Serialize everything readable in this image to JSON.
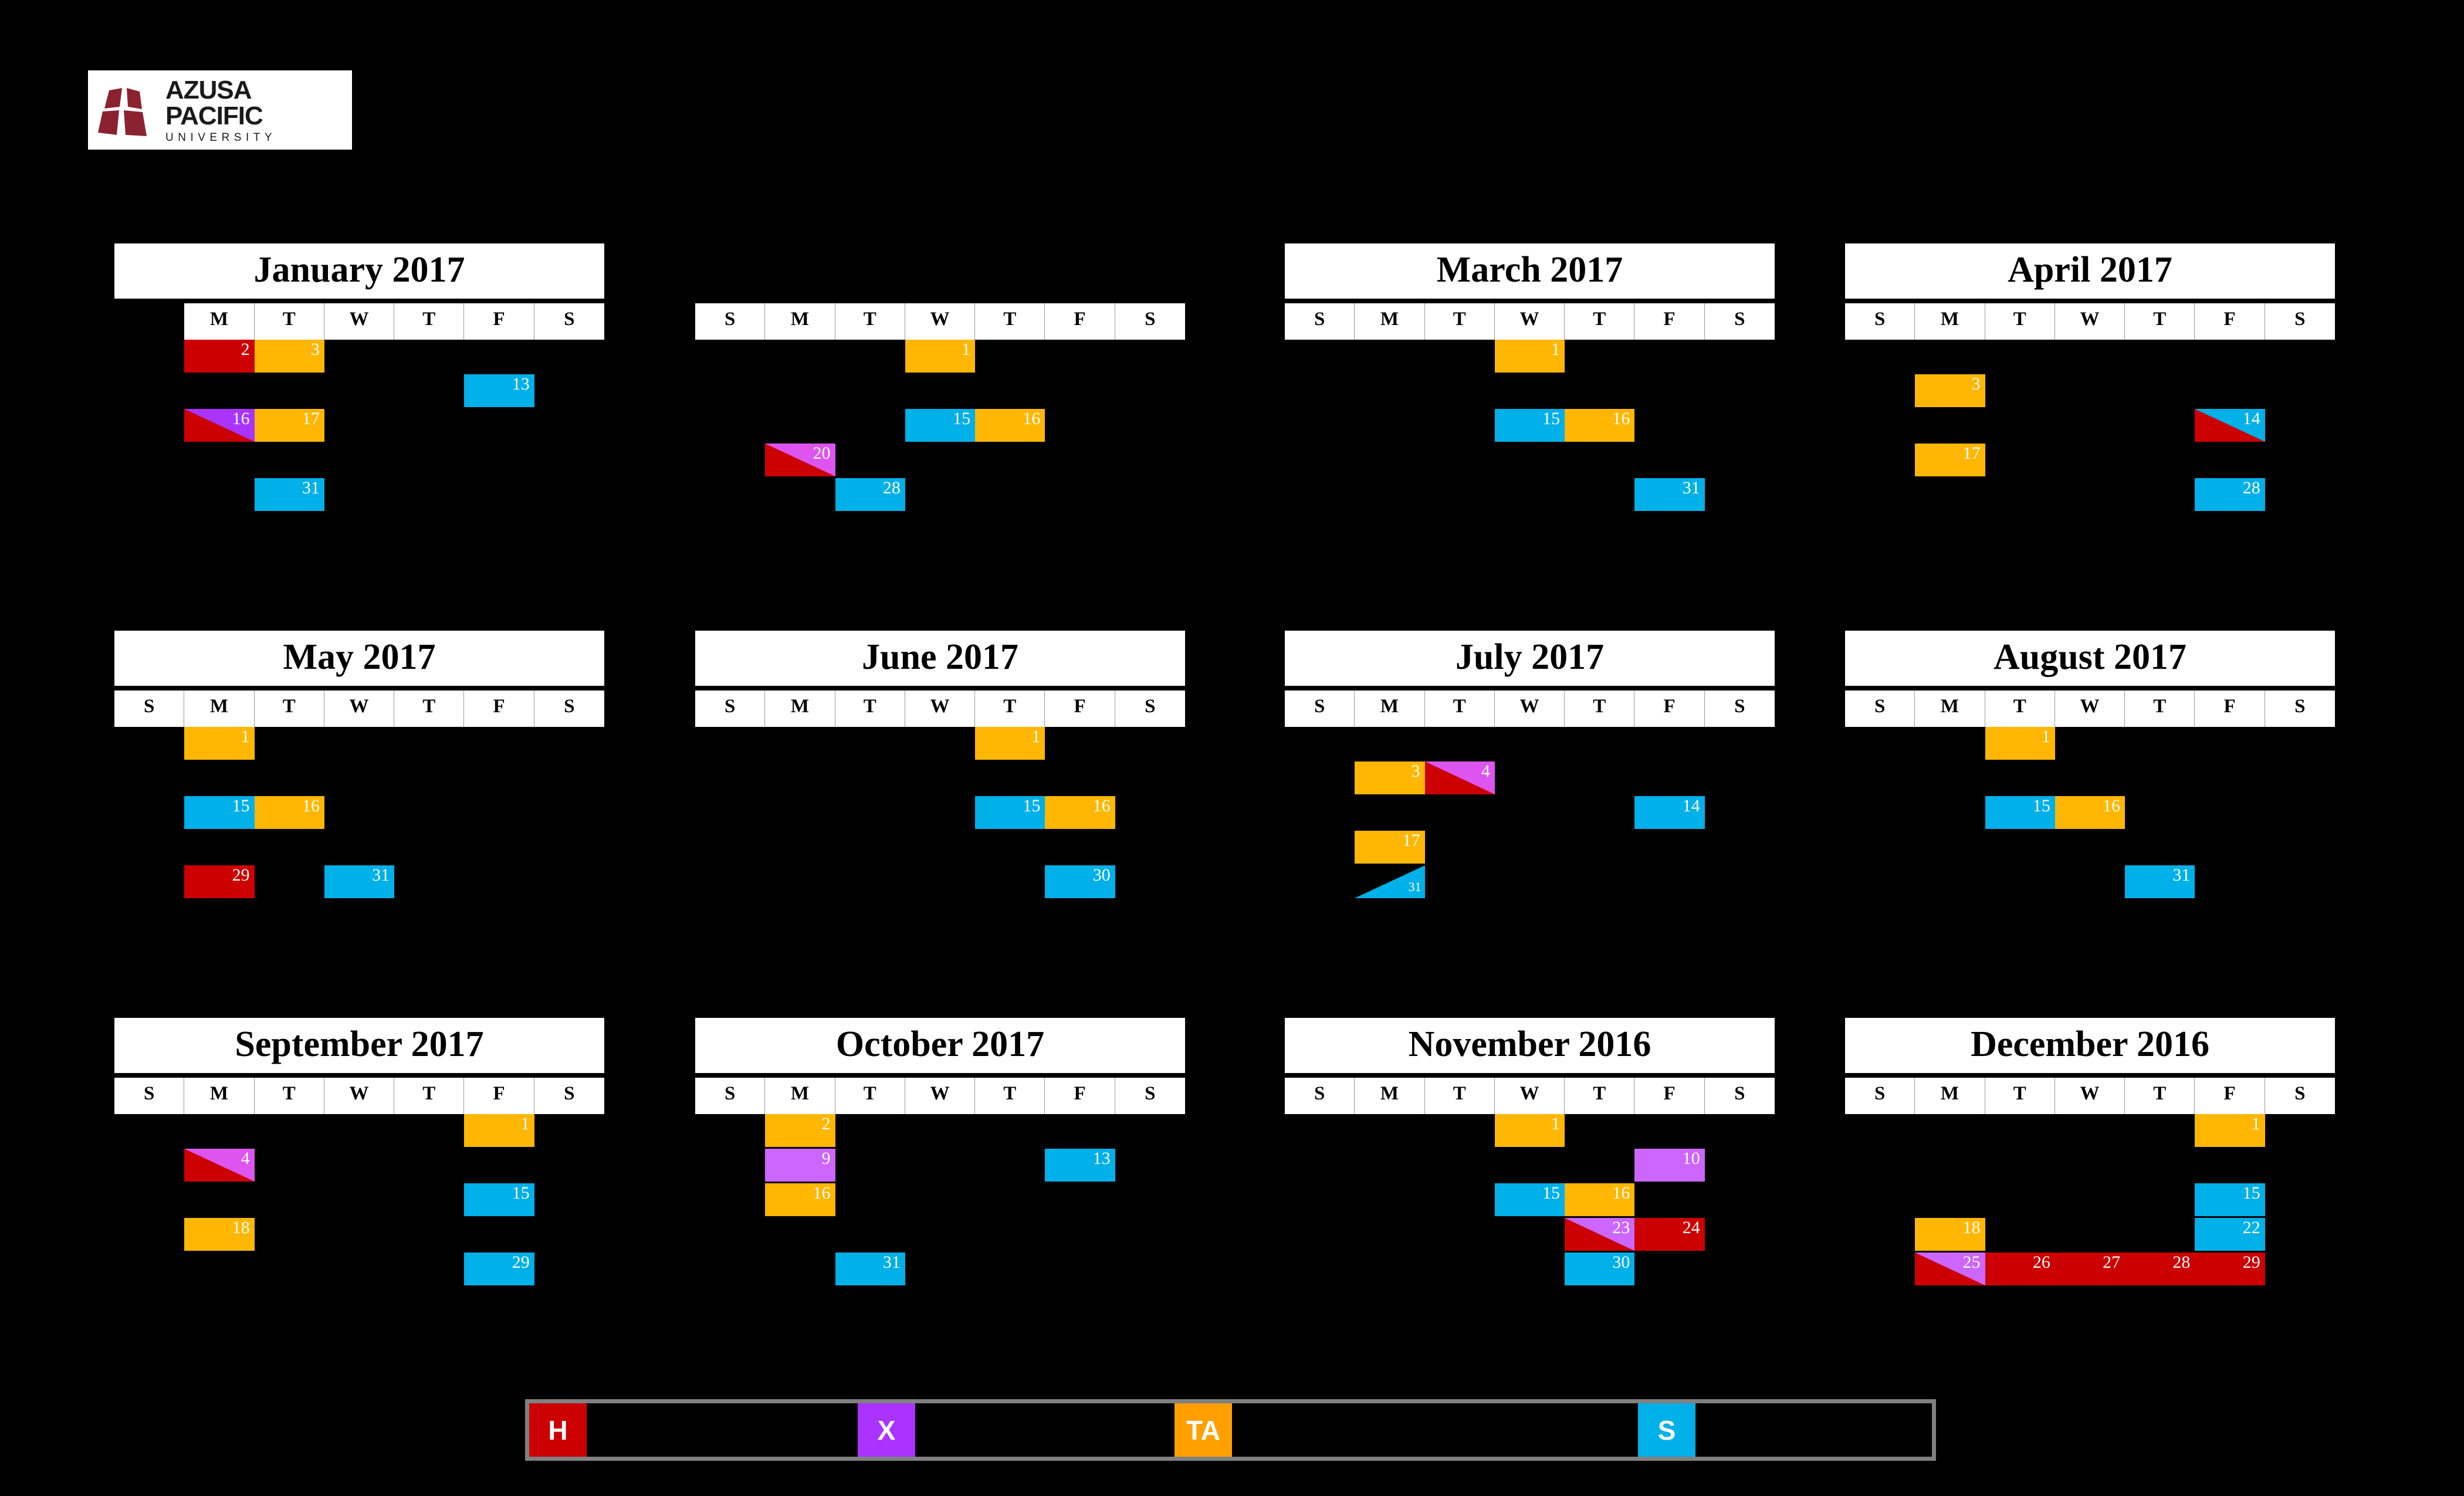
{
  "logo": {
    "title": "AZUSA PACIFIC",
    "subtitle": "UNIVERSITY",
    "mark_color": "#8c2230"
  },
  "colors": {
    "holiday_red": "#cc0000",
    "exam_purple": "#aa33ff",
    "ta_orange": "#ffb703",
    "session_blue": "#00b0e8",
    "background": "#000000",
    "panel_white": "#ffffff",
    "legend_border": "#808080"
  },
  "legend": {
    "items": [
      {
        "key": "H",
        "color": "#cc0000",
        "label": ""
      },
      {
        "key": "X",
        "color": "#aa33ff",
        "label": ""
      },
      {
        "key": "TA",
        "color": "#ffa000",
        "label": ""
      },
      {
        "key": "S",
        "color": "#00b0e8",
        "label": ""
      }
    ]
  },
  "months": [
    {
      "title": "January 2017",
      "title_visible": true,
      "dow": [
        "",
        "M",
        "T",
        "W",
        "T",
        "F",
        "S"
      ],
      "dow_hidden": [
        0
      ],
      "days": [
        {
          "n": "2",
          "col": 1,
          "row": 0,
          "type": "solid",
          "color": "#cc0000"
        },
        {
          "n": "3",
          "col": 2,
          "row": 0,
          "type": "solid",
          "color": "#ffb703"
        },
        {
          "n": "13",
          "col": 5,
          "row": 1,
          "type": "solid",
          "color": "#00b0e8"
        },
        {
          "n": "16",
          "col": 1,
          "row": 2,
          "type": "diag",
          "color": "#cc0000",
          "color2": "#aa33ff"
        },
        {
          "n": "17",
          "col": 2,
          "row": 2,
          "type": "solid",
          "color": "#ffb703"
        },
        {
          "n": "31",
          "col": 2,
          "row": 4,
          "type": "solid",
          "color": "#00b0e8"
        }
      ]
    },
    {
      "title": "",
      "title_visible": false,
      "dow": [
        "S",
        "M",
        "T",
        "W",
        "T",
        "F",
        "S"
      ],
      "dow_hidden": [],
      "days": [
        {
          "n": "1",
          "col": 3,
          "row": 0,
          "type": "solid",
          "color": "#ffb703"
        },
        {
          "n": "15",
          "col": 3,
          "row": 2,
          "type": "solid",
          "color": "#00b0e8"
        },
        {
          "n": "16",
          "col": 4,
          "row": 2,
          "type": "solid",
          "color": "#ffb703"
        },
        {
          "n": "20",
          "col": 1,
          "row": 3,
          "type": "diag",
          "color": "#cc0000",
          "color2": "#dd55ee"
        },
        {
          "n": "28",
          "col": 2,
          "row": 4,
          "type": "solid",
          "color": "#00b0e8"
        }
      ]
    },
    {
      "title": "March 2017",
      "title_visible": true,
      "dow": [
        "S",
        "M",
        "T",
        "W",
        "T",
        "F",
        "S"
      ],
      "dow_hidden": [],
      "days": [
        {
          "n": "1",
          "col": 3,
          "row": 0,
          "type": "solid",
          "color": "#ffb703"
        },
        {
          "n": "15",
          "col": 3,
          "row": 2,
          "type": "solid",
          "color": "#00b0e8"
        },
        {
          "n": "16",
          "col": 4,
          "row": 2,
          "type": "solid",
          "color": "#ffb703"
        },
        {
          "n": "31",
          "col": 5,
          "row": 4,
          "type": "solid",
          "color": "#00b0e8"
        }
      ]
    },
    {
      "title": "April 2017",
      "title_visible": true,
      "dow": [
        "S",
        "M",
        "T",
        "W",
        "T",
        "F",
        "S"
      ],
      "dow_hidden": [],
      "days": [
        {
          "n": "3",
          "col": 1,
          "row": 1,
          "type": "solid",
          "color": "#ffb703"
        },
        {
          "n": "14",
          "col": 5,
          "row": 2,
          "type": "diag",
          "color": "#cc0000",
          "color2": "#00b0e8"
        },
        {
          "n": "17",
          "col": 1,
          "row": 3,
          "type": "solid",
          "color": "#ffb703"
        },
        {
          "n": "28",
          "col": 5,
          "row": 4,
          "type": "solid",
          "color": "#00b0e8"
        }
      ]
    },
    {
      "title": "May 2017",
      "title_visible": true,
      "dow": [
        "S",
        "M",
        "T",
        "W",
        "T",
        "F",
        "S"
      ],
      "dow_hidden": [],
      "days": [
        {
          "n": "1",
          "col": 1,
          "row": 0,
          "type": "solid",
          "color": "#ffb703"
        },
        {
          "n": "15",
          "col": 1,
          "row": 2,
          "type": "solid",
          "color": "#00b0e8"
        },
        {
          "n": "16",
          "col": 2,
          "row": 2,
          "type": "solid",
          "color": "#ffb703"
        },
        {
          "n": "29",
          "col": 1,
          "row": 4,
          "type": "solid",
          "color": "#cc0000"
        },
        {
          "n": "31",
          "col": 3,
          "row": 4,
          "type": "solid",
          "color": "#00b0e8"
        }
      ]
    },
    {
      "title": "June 2017",
      "title_visible": true,
      "dow": [
        "S",
        "M",
        "T",
        "W",
        "T",
        "F",
        "S"
      ],
      "dow_hidden": [],
      "days": [
        {
          "n": "1",
          "col": 4,
          "row": 0,
          "type": "solid",
          "color": "#ffb703"
        },
        {
          "n": "15",
          "col": 4,
          "row": 2,
          "type": "solid",
          "color": "#00b0e8"
        },
        {
          "n": "16",
          "col": 5,
          "row": 2,
          "type": "solid",
          "color": "#ffb703"
        },
        {
          "n": "30",
          "col": 5,
          "row": 4,
          "type": "solid",
          "color": "#00b0e8"
        }
      ]
    },
    {
      "title": "July 2017",
      "title_visible": true,
      "dow": [
        "S",
        "M",
        "T",
        "W",
        "T",
        "F",
        "S"
      ],
      "dow_hidden": [],
      "days": [
        {
          "n": "3",
          "col": 1,
          "row": 1,
          "type": "solid",
          "color": "#ffb703"
        },
        {
          "n": "4",
          "col": 2,
          "row": 1,
          "type": "diag",
          "color": "#cc0000",
          "color2": "#dd55ee"
        },
        {
          "n": "14",
          "col": 5,
          "row": 2,
          "type": "solid",
          "color": "#00b0e8"
        },
        {
          "n": "17",
          "col": 1,
          "row": 3,
          "type": "solid",
          "color": "#ffb703"
        },
        {
          "n": "31",
          "col": 1,
          "row": 4,
          "type": "halftri",
          "color": "#00b0e8",
          "small": true
        }
      ]
    },
    {
      "title": "August 2017",
      "title_visible": true,
      "dow": [
        "S",
        "M",
        "T",
        "W",
        "T",
        "F",
        "S"
      ],
      "dow_hidden": [],
      "days": [
        {
          "n": "1",
          "col": 2,
          "row": 0,
          "type": "solid",
          "color": "#ffb703"
        },
        {
          "n": "15",
          "col": 2,
          "row": 2,
          "type": "solid",
          "color": "#00b0e8"
        },
        {
          "n": "16",
          "col": 3,
          "row": 2,
          "type": "solid",
          "color": "#ffb703"
        },
        {
          "n": "31",
          "col": 4,
          "row": 4,
          "type": "solid",
          "color": "#00b0e8"
        }
      ]
    },
    {
      "title": "September 2017",
      "title_visible": true,
      "dow": [
        "S",
        "M",
        "T",
        "W",
        "T",
        "F",
        "S"
      ],
      "dow_hidden": [],
      "days": [
        {
          "n": "1",
          "col": 5,
          "row": 0,
          "type": "solid",
          "color": "#ffb703"
        },
        {
          "n": "4",
          "col": 1,
          "row": 1,
          "type": "diag",
          "color": "#cc0000",
          "color2": "#dd55ee"
        },
        {
          "n": "15",
          "col": 5,
          "row": 2,
          "type": "solid",
          "color": "#00b0e8"
        },
        {
          "n": "18",
          "col": 1,
          "row": 3,
          "type": "solid",
          "color": "#ffb703"
        },
        {
          "n": "29",
          "col": 5,
          "row": 4,
          "type": "solid",
          "color": "#00b0e8"
        }
      ]
    },
    {
      "title": "October 2017",
      "title_visible": true,
      "dow": [
        "S",
        "M",
        "T",
        "W",
        "T",
        "F",
        "S"
      ],
      "dow_hidden": [],
      "days": [
        {
          "n": "2",
          "col": 1,
          "row": 0,
          "type": "solid",
          "color": "#ffb703"
        },
        {
          "n": "9",
          "col": 1,
          "row": 1,
          "type": "solid",
          "color": "#cc66ff"
        },
        {
          "n": "13",
          "col": 5,
          "row": 1,
          "type": "solid",
          "color": "#00b0e8"
        },
        {
          "n": "16",
          "col": 1,
          "row": 2,
          "type": "solid",
          "color": "#ffb703"
        },
        {
          "n": "31",
          "col": 2,
          "row": 4,
          "type": "solid",
          "color": "#00b0e8"
        }
      ]
    },
    {
      "title": "November 2016",
      "title_visible": true,
      "dow": [
        "S",
        "M",
        "T",
        "W",
        "T",
        "F",
        "S"
      ],
      "dow_hidden": [],
      "days": [
        {
          "n": "1",
          "col": 3,
          "row": 0,
          "type": "solid",
          "color": "#ffb703"
        },
        {
          "n": "10",
          "col": 5,
          "row": 1,
          "type": "solid",
          "color": "#cc66ff"
        },
        {
          "n": "15",
          "col": 3,
          "row": 2,
          "type": "solid",
          "color": "#00b0e8"
        },
        {
          "n": "16",
          "col": 4,
          "row": 2,
          "type": "solid",
          "color": "#ffb703"
        },
        {
          "n": "23",
          "col": 4,
          "row": 3,
          "type": "diag",
          "color": "#cc0000",
          "color2": "#cc66ff"
        },
        {
          "n": "24",
          "col": 5,
          "row": 3,
          "type": "solid",
          "color": "#cc0000"
        },
        {
          "n": "30",
          "col": 4,
          "row": 4,
          "type": "solid",
          "color": "#00b0e8"
        }
      ]
    },
    {
      "title": "December 2016",
      "title_visible": true,
      "dow": [
        "S",
        "M",
        "T",
        "W",
        "T",
        "F",
        "S"
      ],
      "dow_hidden": [],
      "days": [
        {
          "n": "1",
          "col": 5,
          "row": 0,
          "type": "solid",
          "color": "#ffb703"
        },
        {
          "n": "15",
          "col": 5,
          "row": 2,
          "type": "solid",
          "color": "#00b0e8"
        },
        {
          "n": "18",
          "col": 1,
          "row": 3,
          "type": "solid",
          "color": "#ffb703"
        },
        {
          "n": "22",
          "col": 5,
          "row": 3,
          "type": "solid",
          "color": "#00b0e8"
        },
        {
          "n": "25",
          "col": 1,
          "row": 4,
          "type": "diag",
          "color": "#cc0000",
          "color2": "#cc66ff"
        },
        {
          "n": "26",
          "col": 2,
          "row": 4,
          "type": "solid",
          "color": "#cc0000"
        },
        {
          "n": "27",
          "col": 3,
          "row": 4,
          "type": "solid",
          "color": "#cc0000"
        },
        {
          "n": "28",
          "col": 4,
          "row": 4,
          "type": "solid",
          "color": "#cc0000"
        },
        {
          "n": "29",
          "col": 5,
          "row": 4,
          "type": "solid",
          "color": "#cc0000"
        }
      ]
    }
  ],
  "layout": {
    "columns_x": [
      195,
      1185,
      2190,
      3145
    ],
    "rows_y": [
      415,
      1075,
      1735
    ]
  }
}
